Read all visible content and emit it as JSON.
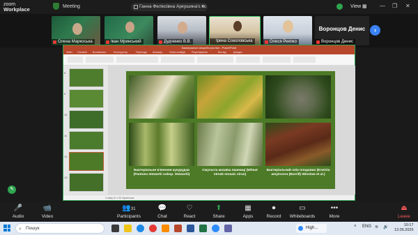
{
  "app": {
    "brand_line1": "zoom",
    "brand_line2": "Workplace",
    "meeting_label": "Meeting"
  },
  "share_pill": {
    "text": "Ганна Феліксівна Аркушина's sc"
  },
  "window": {
    "view_label": "View",
    "minimize": "—",
    "restore": "❐",
    "close": "✕"
  },
  "participants": [
    {
      "name": "Олена Маркоська"
    },
    {
      "name": "Іван Мринський"
    },
    {
      "name": "Дудченко В.В."
    },
    {
      "name": "Ірина Соколовська"
    },
    {
      "name": "Олеся Реяпко"
    },
    {
      "name": "Воронцов Денис",
      "big": "Воронцов Денис"
    }
  ],
  "strip_next": "›",
  "ppt": {
    "title": "Бактеріальні хвороби рослин - PowerPoint",
    "tabs": [
      "Файл",
      "Основне",
      "Вставлення",
      "Конструктор",
      "Переходи",
      "Анімація",
      "Показ слайдів",
      "Рецензування",
      "Вигляд",
      "Довідка"
    ],
    "thumb_numbers": [
      "8",
      "9",
      "10",
      "11",
      "12",
      "13"
    ],
    "status": "Слайд 13 з 30   Українська"
  },
  "slide": {
    "captions": [
      "Бактеріальне в'янення кукурудзи (Pantoea stewartii subsp. Stewartii)",
      "Смугаста мозаїка пшениці (Wheat streak mosaic virus)",
      "Бактеріальний опік плодових (Erwinia amylovora (Burrill) Winslow et al.)"
    ]
  },
  "toolbar": {
    "items": [
      {
        "icon": "🎤",
        "label": "Audio"
      },
      {
        "icon": "📹",
        "label": "Video"
      },
      {
        "icon": "👥",
        "label": "Participants",
        "count": "31"
      },
      {
        "icon": "💬",
        "label": "Chat"
      },
      {
        "icon": "♡",
        "label": "React"
      },
      {
        "icon": "⬆",
        "label": "Share"
      },
      {
        "icon": "▦",
        "label": "Apps"
      },
      {
        "icon": "⏺",
        "label": "Record"
      },
      {
        "icon": "▭",
        "label": "Whiteboards"
      },
      {
        "icon": "•••",
        "label": "More"
      }
    ],
    "leave_label": "Leave"
  },
  "taskbar": {
    "search_placeholder": "Пошук",
    "tray_app_label": "High...",
    "lang": "ENG",
    "time": "10:17",
    "date": "13.05.2025"
  },
  "colors": {
    "accent_green": "#2ea44f",
    "ppt_red": "#b7472a",
    "zoom_blue": "#2d8cff"
  }
}
